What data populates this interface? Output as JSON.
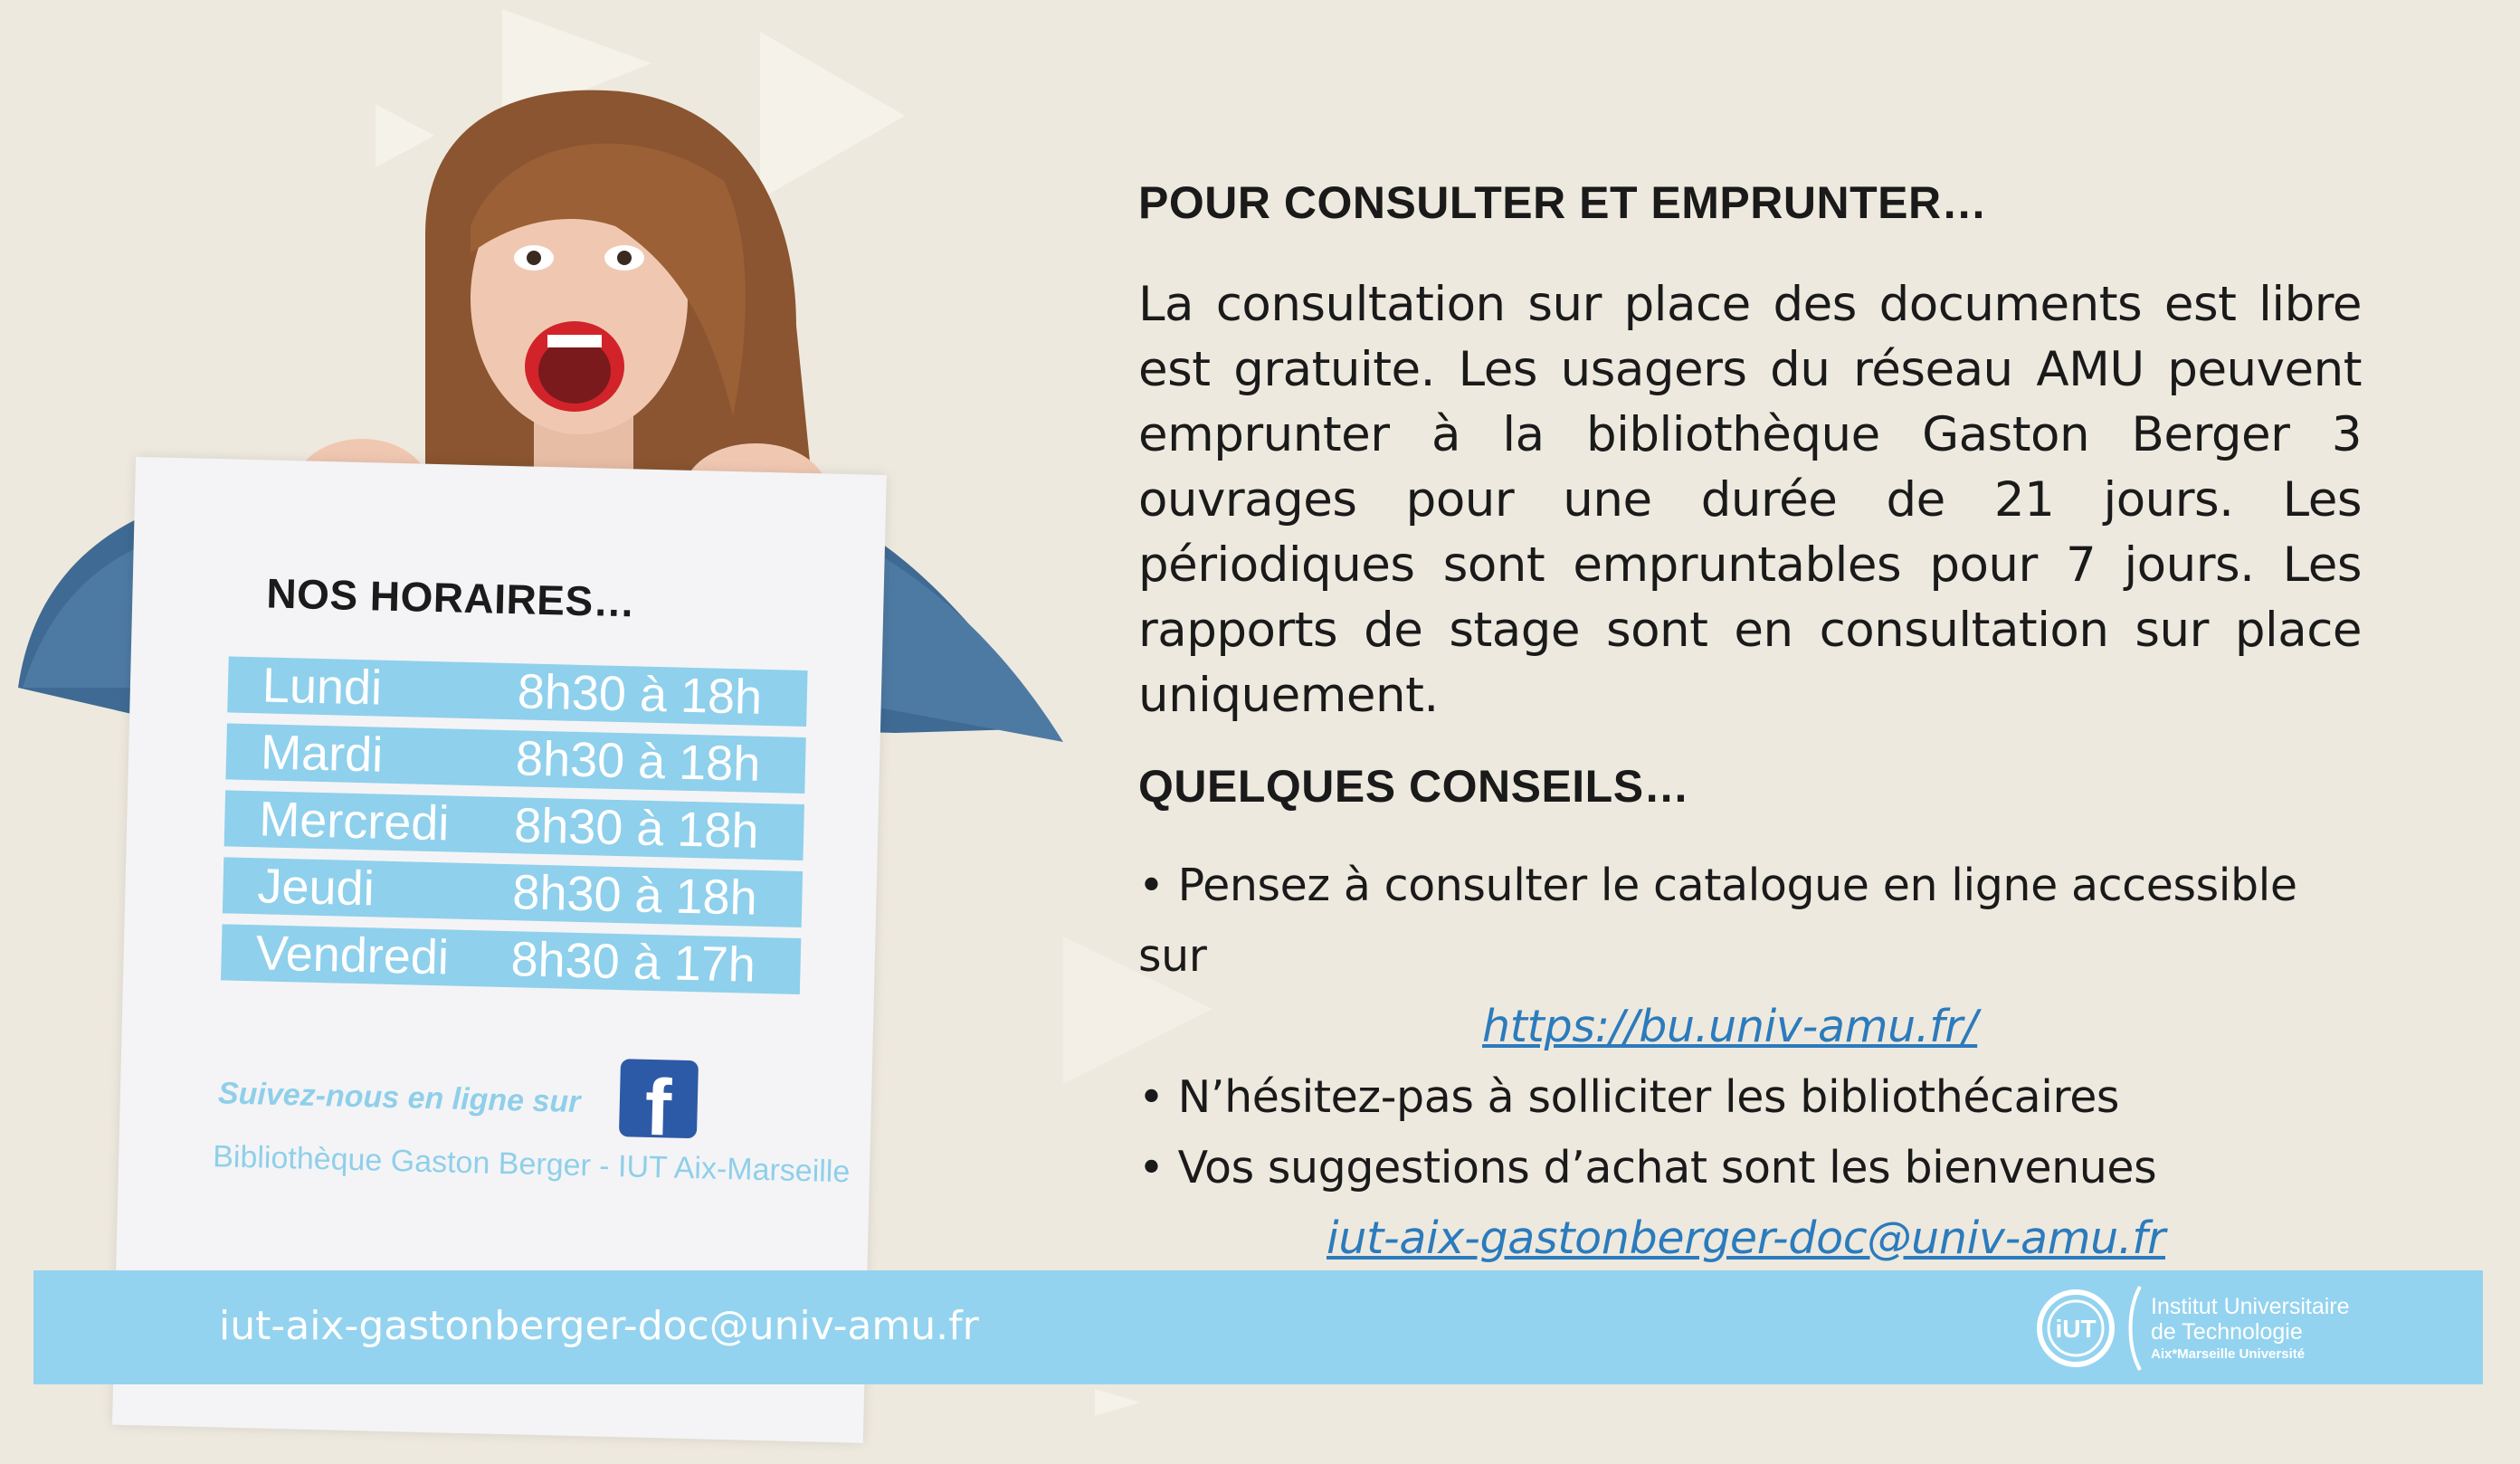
{
  "poster": {
    "title": "NOS HORAIRES…",
    "hours": [
      {
        "day": "Lundi",
        "time": "8h30 à 18h"
      },
      {
        "day": "Mardi",
        "time": "8h30 à 18h"
      },
      {
        "day": "Mercredi",
        "time": "8h30 à 18h"
      },
      {
        "day": "Jeudi",
        "time": "8h30 à 18h"
      },
      {
        "day": "Vendredi",
        "time": "8h30 à 17h"
      }
    ],
    "follow_text": "Suivez-nous en ligne sur",
    "facebook_icon": "facebook-icon",
    "library_name": "Bibliothèque Gaston Berger - IUT Aix-Marseille"
  },
  "consult": {
    "heading": "POUR CONSULTER ET EMPRUNTER…",
    "paragraph": "La consultation sur place des documents est libre est gratuite. Les usagers du réseau AMU peuvent emprunter à la bibliothèque Gaston Berger 3 ouvrages pour une durée de 21 jours.  Les périodiques sont empruntables pour 7 jours. Les rapports de stage sont en consultation sur place uniquement."
  },
  "advice": {
    "heading": "QUELQUES CONSEILS…",
    "tip1": "• Pensez à consulter le catalogue en ligne accessible sur",
    "catalog_link": "https://bu.univ-amu.fr/",
    "tip2": "• N’hésitez-pas à solliciter les bibliothécaires",
    "tip3": "• Vos suggestions d’achat sont les bienvenues",
    "email_link": "iut-aix-gastonberger-doc@univ-amu.fr"
  },
  "footer": {
    "email": "iut-aix-gastonberger-doc@univ-amu.fr",
    "logo_icon": "iut-logo-icon",
    "logo_line1": "Institut Universitaire",
    "logo_line2": "de Technologie",
    "logo_line3": "Aix*Marseille Université"
  },
  "colors": {
    "background": "#eee9de",
    "accent_blue": "#93d3ef",
    "link_blue": "#2b7bbd",
    "facebook_blue": "#2d5aa6"
  }
}
